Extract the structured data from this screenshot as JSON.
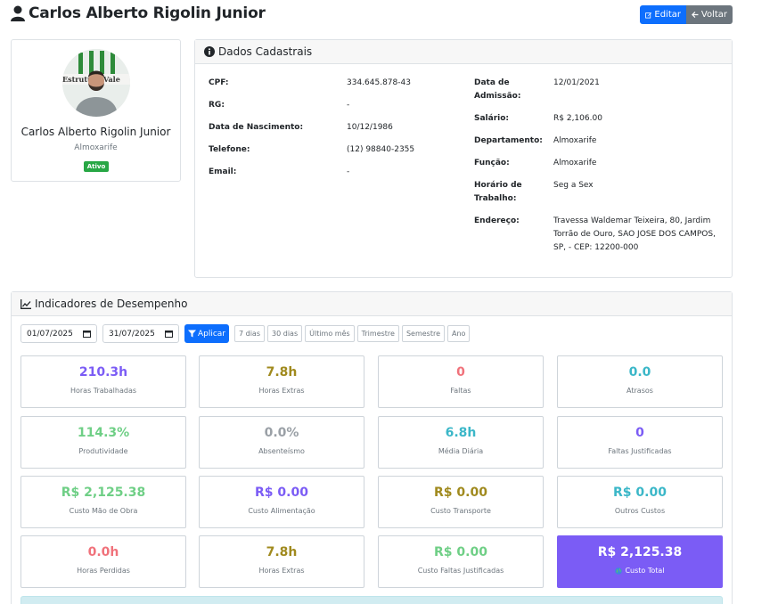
{
  "page": {
    "title": "Carlos Alberto Rigolin Junior"
  },
  "actions": {
    "edit_label": "Editar",
    "back_label": "Voltar"
  },
  "profile": {
    "name": "Carlos Alberto Rigolin Junior",
    "role": "Almoxarife",
    "status": "Ativo",
    "photo_sign_text": "Estrutura Vale"
  },
  "details": {
    "header": "Dados Cadastrais",
    "left": [
      {
        "label": "CPF:",
        "value": "334.645.878-43"
      },
      {
        "label": "RG:",
        "value": "-"
      },
      {
        "label": "Data de Nascimento:",
        "value": "10/12/1986"
      },
      {
        "label": "Telefone:",
        "value": "(12) 98840-2355"
      },
      {
        "label": "Email:",
        "value": "-"
      }
    ],
    "right": [
      {
        "label_line1": "Data de",
        "label_line2": "Admissão:",
        "value": "12/01/2021"
      },
      {
        "label_line1": "Salário:",
        "value": "R$ 2,106.00"
      },
      {
        "label_line1": "Departamento:",
        "value": "Almoxarife"
      },
      {
        "label_line1": "Função:",
        "value": "Almoxarife"
      },
      {
        "label_line1": "Horário de",
        "label_line2": "Trabalho:",
        "value": "Seg a Sex"
      },
      {
        "label_line1": "Endereço:",
        "value_line1": "Travessa Waldemar Teixeira, 80, Jardim",
        "value_line2": "Torrão de Ouro, SAO JOSE DOS CAMPOS,",
        "value_line3": "SP, - CEP: 12200-000"
      }
    ]
  },
  "performance": {
    "header": "Indicadores de Desempenho",
    "date_from": "01/07/2025",
    "date_to": "31/07/2025",
    "apply_label": "Aplicar",
    "presets": [
      "7 dias",
      "30 dias",
      "Último mês",
      "Trimestre",
      "Semestre",
      "Ano"
    ],
    "metrics": [
      {
        "value": "210.3h",
        "label": "Horas Trabalhadas",
        "color": "#7b5cf5"
      },
      {
        "value": "7.8h",
        "label": "Horas Extras",
        "color": "#a08a1e"
      },
      {
        "value": "0",
        "label": "Faltas",
        "color": "#f0727b"
      },
      {
        "value": "0.0",
        "label": "Atrasos",
        "color": "#3bb7c8"
      },
      {
        "value": "114.3%",
        "label": "Produtividade",
        "color": "#6fcf86"
      },
      {
        "value": "0.0%",
        "label": "Absenteísmo",
        "color": "#9aa0a6"
      },
      {
        "value": "6.8h",
        "label": "Média Diária",
        "color": "#3bb7c8"
      },
      {
        "value": "0",
        "label": "Faltas Justificadas",
        "color": "#7b5cf5"
      },
      {
        "value": "R$ 2,125.38",
        "label": "Custo Mão de Obra",
        "color": "#6fcf86"
      },
      {
        "value": "R$ 0.00",
        "label": "Custo Alimentação",
        "color": "#7b5cf5"
      },
      {
        "value": "R$ 0.00",
        "label": "Custo Transporte",
        "color": "#a08a1e"
      },
      {
        "value": "R$ 0.00",
        "label": "Outros Custos",
        "color": "#3bb7c8"
      },
      {
        "value": "0.0h",
        "label": "Horas Perdidas",
        "color": "#f0727b"
      },
      {
        "value": "7.8h",
        "label": "Horas Extras",
        "color": "#a08a1e"
      },
      {
        "value": "R$ 0.00",
        "label": "Custo Faltas Justificadas",
        "color": "#6fcf86"
      },
      {
        "value": "R$ 2,125.38",
        "label": "Custo Total",
        "color": "#ffffff"
      }
    ]
  }
}
